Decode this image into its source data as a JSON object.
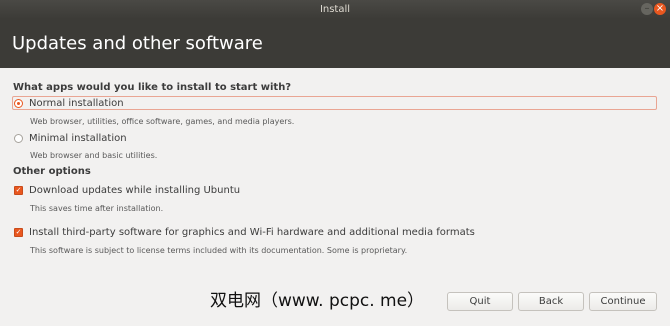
{
  "window": {
    "title": "Install",
    "minimize_glyph": "–",
    "close_glyph": "×"
  },
  "header": {
    "title": "Updates and other software"
  },
  "question": "What apps would you like to install to start with?",
  "install_options": [
    {
      "label": "Normal installation",
      "description": "Web browser, utilities, office software, games, and media players.",
      "selected": true
    },
    {
      "label": "Minimal installation",
      "description": "Web browser and basic utilities.",
      "selected": false
    }
  ],
  "other_options": {
    "title": "Other options",
    "items": [
      {
        "label": "Download updates while installing Ubuntu",
        "description": "This saves time after installation.",
        "checked": true
      },
      {
        "label": "Install third-party software for graphics and Wi-Fi hardware and additional media formats",
        "description": "This software is subject to license terms included with its documentation. Some is proprietary.",
        "checked": true
      }
    ]
  },
  "buttons": {
    "quit": "Quit",
    "back": "Back",
    "continue": "Continue"
  },
  "watermark": "双电网（www. pcpc. me）",
  "colors": {
    "accent": "#e9571f",
    "header_bg": "#3c3b37",
    "window_bg": "#f2f1f0"
  }
}
